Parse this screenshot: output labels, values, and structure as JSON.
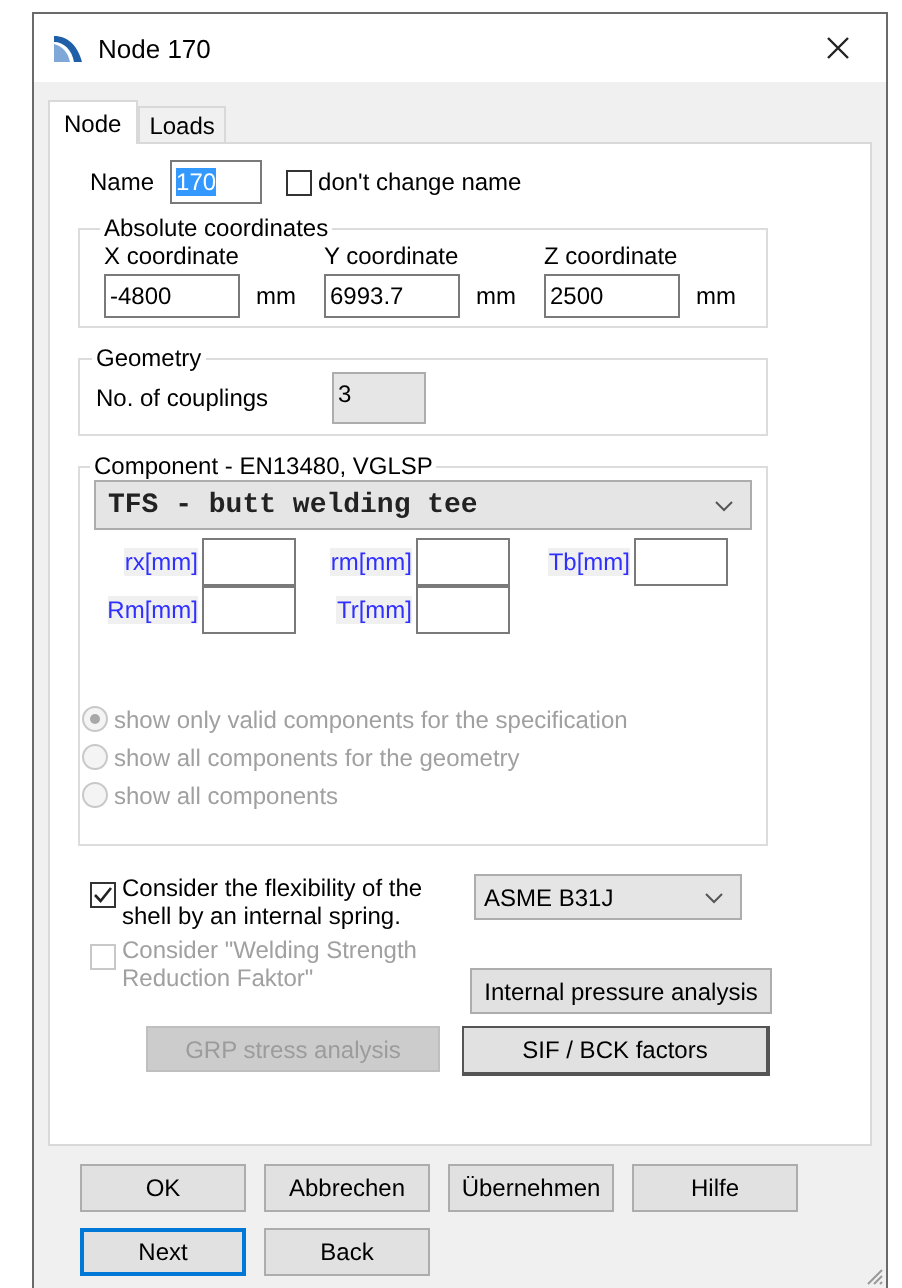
{
  "window": {
    "title": "Node 170"
  },
  "tabs": [
    {
      "label": "Node",
      "selected": true
    },
    {
      "label": "Loads",
      "selected": false
    }
  ],
  "name_field": {
    "label": "Name",
    "value": "170",
    "text_selected": true
  },
  "keep_name": {
    "label": "don't change name",
    "checked": false
  },
  "coordinates": {
    "title": "Absolute coordinates",
    "fields": [
      {
        "label": "X coordinate",
        "value": "-4800",
        "unit": "mm"
      },
      {
        "label": "Y coordinate",
        "value": "6993.7",
        "unit": "mm"
      },
      {
        "label": "Z coordinate",
        "value": "2500",
        "unit": "mm"
      }
    ]
  },
  "geometry": {
    "title": "Geometry",
    "label": "No. of couplings",
    "value": "3",
    "disabled": true
  },
  "component": {
    "title": "Component - EN13480, VGLSP",
    "type": "TFS - butt welding tee",
    "params": [
      [
        {
          "label": "rx[mm]"
        },
        {
          "label": "rm[mm]"
        },
        {
          "label": "Tb[mm]"
        }
      ],
      [
        {
          "label": "Rm[mm]"
        },
        {
          "label": "Tr[mm]"
        }
      ]
    ],
    "filters": [
      {
        "label": "show only valid components for the specification",
        "selected": true,
        "disabled": true
      },
      {
        "label": "show all components for the geometry",
        "selected": false,
        "disabled": true
      },
      {
        "label": "show all components",
        "selected": false,
        "disabled": true
      }
    ]
  },
  "flexibility": {
    "label": "Consider the flexibility of the shell by an internal spring.",
    "checked": true,
    "disabled": false
  },
  "method": {
    "value": "ASME B31J"
  },
  "welding": {
    "label": "Consider \"Welding Strength Reduction Faktor\"",
    "checked": false,
    "disabled": true
  },
  "internal_pressure": {
    "label": "Internal pressure analysis",
    "disabled": false
  },
  "grp": {
    "label": "GRP stress analysis",
    "disabled": true
  },
  "sif": {
    "label": "SIF / BCK factors",
    "disabled": false
  },
  "footer": [
    [
      {
        "label": "OK",
        "focused": false
      },
      {
        "label": "Abbrechen",
        "focused": false
      },
      {
        "label": "Übernehmen",
        "focused": false
      },
      {
        "label": "Hilfe",
        "focused": false
      }
    ],
    [
      {
        "label": "Next",
        "focused": true
      },
      {
        "label": "Back",
        "focused": false
      }
    ]
  ]
}
